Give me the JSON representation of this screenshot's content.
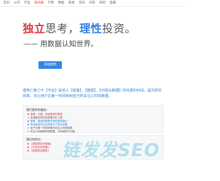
{
  "nav": {
    "items": [
      {
        "label": "首页",
        "active": false
      },
      {
        "label": "公司",
        "active": false
      },
      {
        "label": "行业",
        "active": false
      },
      {
        "label": "快讯通",
        "active": true
      },
      {
        "label": "行情",
        "active": false
      },
      {
        "label": "数据",
        "active": false
      },
      {
        "label": "基金",
        "active": false
      },
      {
        "label": "资讯",
        "active": false
      },
      {
        "label": "问答",
        "active": false
      },
      {
        "label": "研究",
        "active": false
      },
      {
        "label": "直播",
        "active": false
      }
    ]
  },
  "hero": {
    "title_red": "独立",
    "title_mid": "思考，",
    "title_blue": "理性",
    "title_end": "投资。",
    "subtitle": "—— 用数据认知世界。",
    "cta_label": "开始使用"
  },
  "intro": "理杏仁致力于【节省】投资人【收集】、【整理】、【可视化数据】所花费的时间，提升研究效率，并让用户在第一时间得到自己所关注公司的数据。",
  "panel1": {
    "title": "我们提供的服务：",
    "items": [
      {
        "text": "准确、可靠、快速更新的数据",
        "tone": "red"
      },
      {
        "text": "多维度多样化的数据分析工具",
        "tone": "normal"
      },
      {
        "text": "清晰、直观的数据可视化图表展示",
        "tone": "blue"
      },
      {
        "text": "简洁易用的交互界面与个性化设置",
        "tone": "blue"
      },
      {
        "text": "用户在第一时间获取所关注公司的数据",
        "tone": "normal"
      },
      {
        "text": "关注公司最新财报数据，分析趋势与价值",
        "tone": "normal"
      }
    ]
  },
  "panel2": {
    "title": "我们的特点：",
    "items": [
      {
        "text": "【数据更新的速度】",
        "tone": "red"
      },
      {
        "text": "【可视化的数据】",
        "tone": "red"
      },
      {
        "text": "【数据的准确性】",
        "tone": "red"
      }
    ]
  },
  "watermark": "链发发SEO"
}
